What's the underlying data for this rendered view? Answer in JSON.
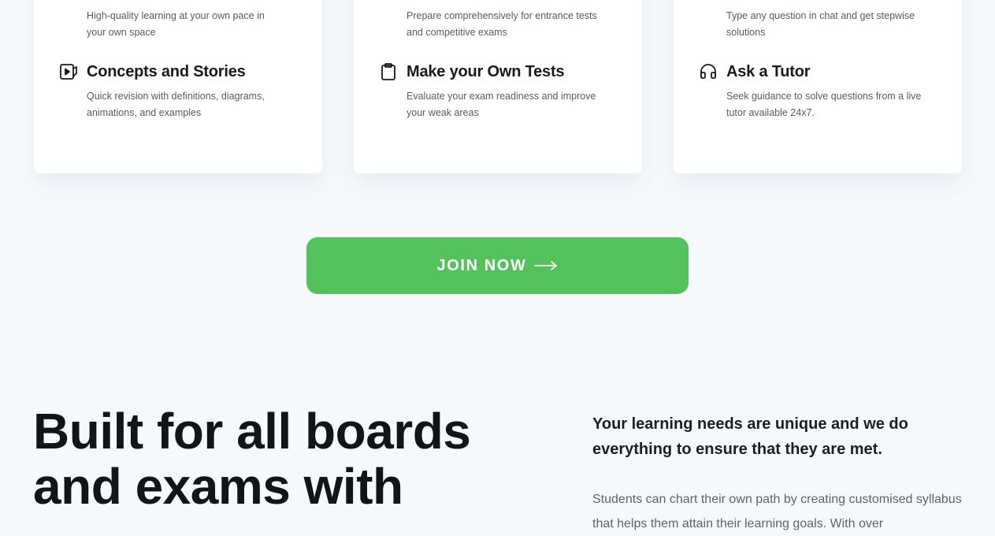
{
  "features": {
    "card1": {
      "top": {
        "icon": "none",
        "description": "High-quality learning at your own pace in your own space"
      },
      "bottom": {
        "icon": "play-video-icon",
        "title": "Concepts and Stories",
        "description": "Quick revision with definitions, diagrams, animations, and examples"
      }
    },
    "card2": {
      "top": {
        "icon": "none",
        "description": "Prepare comprehensively for entrance tests and competitive exams"
      },
      "bottom": {
        "icon": "clipboard-icon",
        "title": "Make your Own Tests",
        "description": "Evaluate your exam readiness and improve your weak areas"
      }
    },
    "card3": {
      "top": {
        "icon": "none",
        "description": "Type any question in chat and get stepwise solutions"
      },
      "bottom": {
        "icon": "headphones-icon",
        "title": "Ask a Tutor",
        "description": "Seek guidance to solve questions from a live tutor available 24x7."
      }
    }
  },
  "cta": {
    "label": "JOIN NOW",
    "icon": "long-arrow-right-icon",
    "color": "#55c15d"
  },
  "section": {
    "headline_line1": "Built for all boards",
    "headline_line2": "and exams with",
    "headline_accent_color": "#2d8ee8",
    "subhead": "Your learning needs are unique and we do everything to ensure that they are met.",
    "body": "Students can chart their own path by creating customised syllabus that helps them attain their learning goals. With over"
  }
}
